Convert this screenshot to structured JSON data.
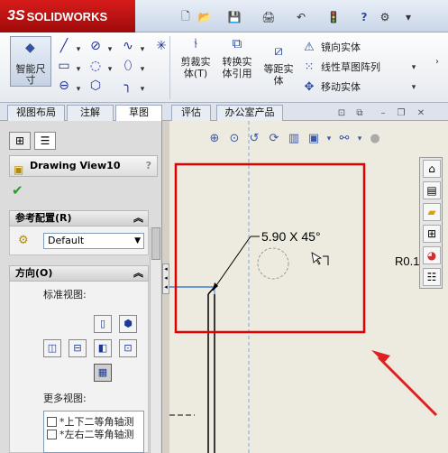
{
  "app": {
    "logo_ds": "3S",
    "logo_name": "SOLIDWORKS"
  },
  "quick_access": {
    "new": "🗋",
    "open": "📂",
    "save": "💾",
    "print": "🖨",
    "undo": "↶",
    "rebuild": "🚦",
    "help": "?",
    "options": "⚙"
  },
  "ribbon": {
    "smart_dimension": {
      "line1": "智能尺",
      "line2": "寸",
      "icon": "smart-dimension-icon"
    },
    "trim": {
      "line1": "剪裁实",
      "line2": "体(T)"
    },
    "convert": {
      "line1": "转换实",
      "line2": "体引用"
    },
    "offset": {
      "line1": "等距实",
      "line2": "体"
    },
    "mirror": "镜向实体",
    "linear_pattern": "线性草图阵列",
    "move": "移动实体"
  },
  "tabs": [
    "视图布局",
    "注解",
    "草图",
    "评估",
    "办公室产品"
  ],
  "active_tab": "草图",
  "property_manager": {
    "title": "Drawing View10",
    "help": "?",
    "ref_config_label": "参考配置(R)",
    "ref_config_value": "Default",
    "orientation_label": "方向(O)",
    "standard_views_label": "标准视图:",
    "more_views_label": "更多视图:",
    "more_views": [
      "*上下二等角轴测",
      "*左右二等角轴测"
    ]
  },
  "drawing": {
    "dimension_text": "5.90 X 45°",
    "label_r": "R0.1"
  },
  "colors": {
    "highlight": "#e00000",
    "arrow": "#e02020",
    "accent": "#2a4aa0"
  }
}
